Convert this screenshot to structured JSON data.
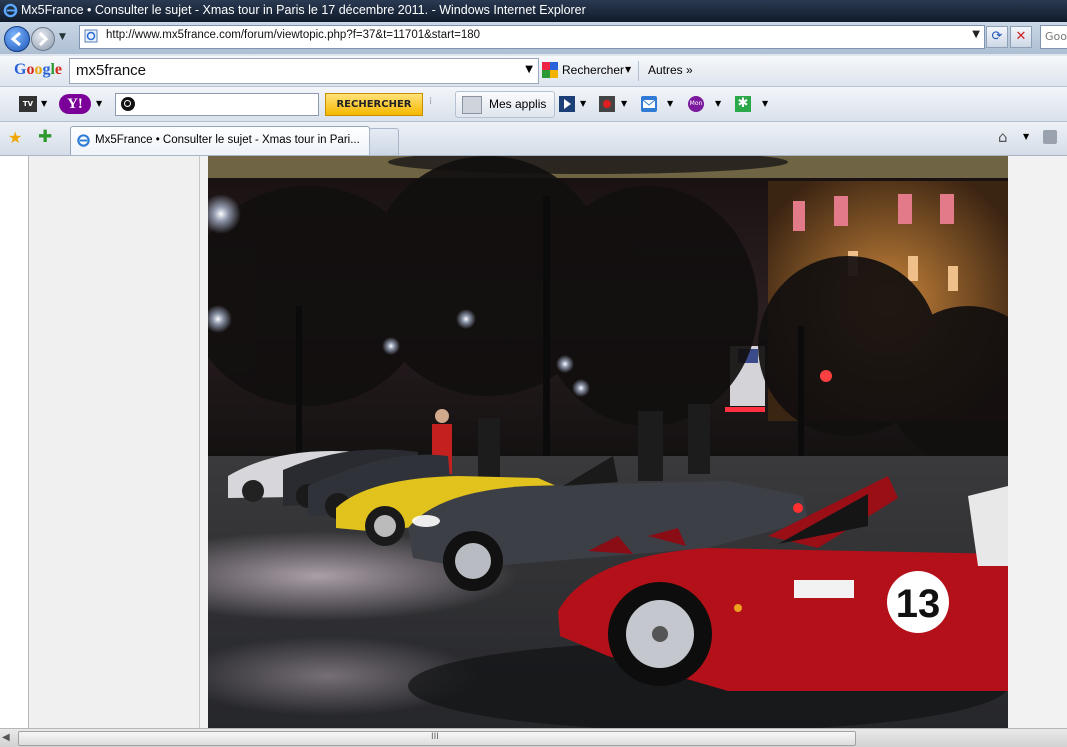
{
  "window": {
    "title": "Mx5France • Consulter le sujet - Xmas tour in Paris le 17 décembre 2011. - Windows Internet Explorer"
  },
  "address_bar": {
    "url": "http://www.mx5france.com/forum/viewtopic.php?f=37&t=11701&start=180"
  },
  "search_box": {
    "placeholder": "Goo"
  },
  "google_toolbar": {
    "logo": "Google",
    "query": "mx5france",
    "search_label": "Rechercher",
    "more_label": "Autres »"
  },
  "yahoo_toolbar": {
    "tv_label": "TV",
    "yahoo_label": "Y!",
    "search_button": "RECHERCHER",
    "apps_label": "Mes applis",
    "mon_label": "Mon"
  },
  "tab": {
    "title": "Mx5France • Consulter le sujet - Xmas tour in Pari..."
  },
  "photo": {
    "race_number": "13"
  },
  "scrollbar": {
    "grip": "III"
  },
  "colors": {
    "car_red": "#b4101a",
    "car_yellow": "#e2c21c",
    "car_gray": "#3c3f46",
    "toolbar_bg": "#d9e1eb"
  }
}
